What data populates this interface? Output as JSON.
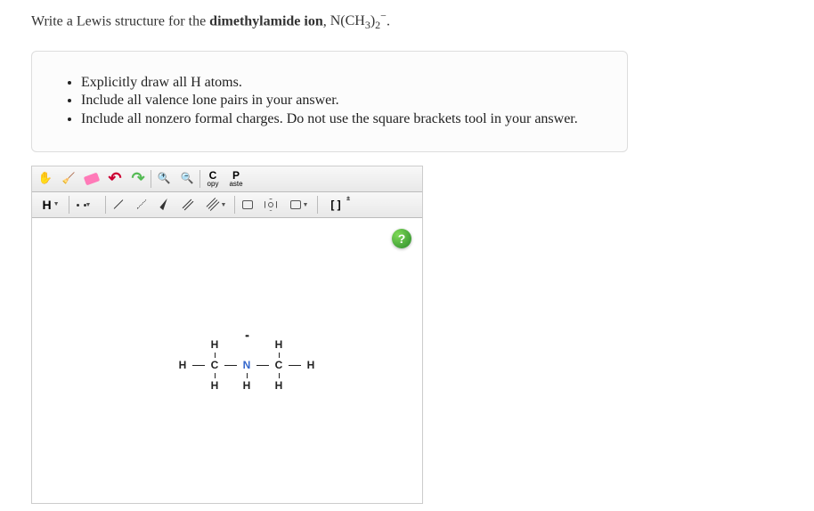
{
  "question": {
    "prefix": "Write a Lewis structure for the ",
    "bold": "dimethylamide ion",
    "suffix": ", ",
    "formula_base": "N(CH",
    "formula_sub1": "3",
    "formula_mid": ")",
    "formula_sub2": "2",
    "formula_sup": "−",
    "end": "."
  },
  "instructions": [
    "Explicitly draw all H atoms.",
    "Include all valence lone pairs in your answer.",
    "Include all nonzero formal charges. Do not use the square brackets tool in your answer."
  ],
  "toolbar1": {
    "copy_top": "C",
    "copy_bot": "opy",
    "paste_top": "P",
    "paste_bot": "aste"
  },
  "toolbar2": {
    "element": "H",
    "bracket": "[ ]",
    "charge": "±"
  },
  "help": "?",
  "molecule": {
    "H": "H",
    "C": "C",
    "N": "N",
    "lone_pair": "••"
  }
}
